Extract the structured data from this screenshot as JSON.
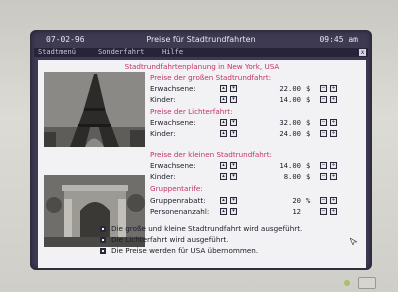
{
  "window": {
    "date": "07-02-96",
    "title": "Preise für Stadtrundfahrten",
    "clock": "09:45 am"
  },
  "menu": {
    "items": [
      "Stadtmenü",
      "Sonderfahrt",
      "Hilfe"
    ],
    "close": "x"
  },
  "panel": {
    "heading": "Stadtrundfahrtenplanung in New York, USA",
    "big_tour": {
      "section": "Preise der großen Stadtrundfahrt:",
      "rows": [
        {
          "label": "Erwachsene:",
          "value": "22.00",
          "unit": "$"
        },
        {
          "label": "Kinder:",
          "value": "14.00",
          "unit": "$"
        }
      ]
    },
    "light_tour": {
      "section": "Preise der Lichterfahrt:",
      "rows": [
        {
          "label": "Erwachsene:",
          "value": "32.00",
          "unit": "$"
        },
        {
          "label": "Kinder:",
          "value": "24.00",
          "unit": "$"
        }
      ]
    },
    "small_tour": {
      "section": "Preise der kleinen Stadtrundfahrt:",
      "rows": [
        {
          "label": "Erwachsene:",
          "value": "14.00",
          "unit": "$"
        },
        {
          "label": "Kinder:",
          "value": "8.00",
          "unit": "$"
        }
      ]
    },
    "group": {
      "section": "Gruppentarife:",
      "rows": [
        {
          "label": "Gruppenrabatt:",
          "value": "20",
          "unit": "%"
        },
        {
          "label": "Personenanzahl:",
          "value": "12",
          "unit": ""
        }
      ]
    },
    "status": [
      "Die große und kleine Stadtrundfahrt wird ausgeführt.",
      "Die Lichterfahrt wird ausgeführt.",
      "Die Preise werden für USA übernommen."
    ],
    "photos": [
      "eiffel-tower-photo",
      "monument-photo"
    ]
  },
  "colors": {
    "accent": "#c23468",
    "screen": "#3d3a52",
    "panel": "#f2f1f3"
  }
}
